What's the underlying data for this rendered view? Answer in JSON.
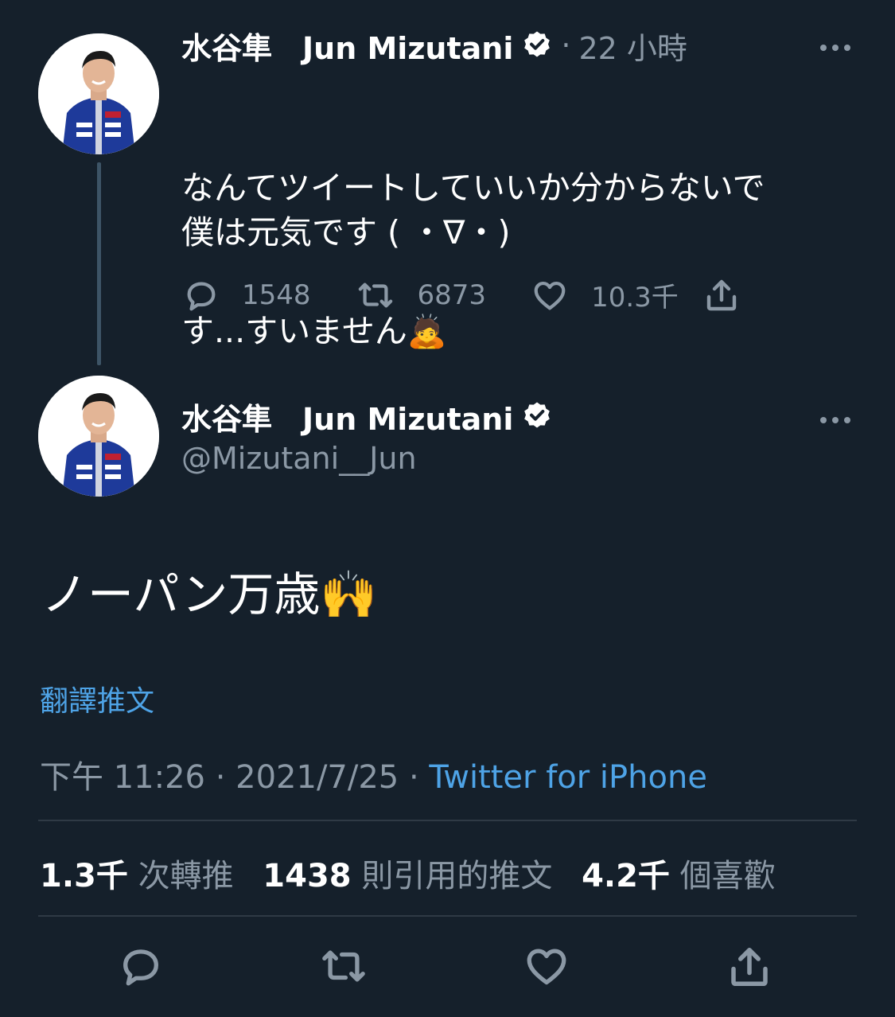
{
  "tweet1": {
    "display_name": "水谷隼　Jun Mizutani",
    "separator": "·",
    "time_ago": "22 小時",
    "text_line1": "なんてツイートしていいか分からないで",
    "text_line2": "す...すいません",
    "text_emoji": "🙇",
    "text_line3": "僕は元気です ( ・∇・)",
    "replies": "1548",
    "retweets": "6873",
    "likes": "10.3千",
    "more_icon": "ellipsis-icon"
  },
  "tweet2": {
    "display_name": "水谷隼　Jun Mizutani",
    "handle": "@Mizutani__Jun",
    "text": "ノーパン万歳",
    "text_emoji": "🙌",
    "translate_label": "翻譯推文",
    "time": "下午 11:26",
    "sep1": "·",
    "date": "2021/7/25",
    "sep2": "·",
    "source": "Twitter for iPhone",
    "stats": {
      "retweets_value": "1.3千",
      "retweets_label": "次轉推",
      "quotes_value": "1438",
      "quotes_label": "則引用的推文",
      "likes_value": "4.2千",
      "likes_label": "個喜歡"
    },
    "more_icon": "ellipsis-icon"
  },
  "colors": {
    "background": "#15202b",
    "link": "#4ea3e6",
    "secondary_text": "#8b98a5",
    "divider": "#2f3a45"
  }
}
